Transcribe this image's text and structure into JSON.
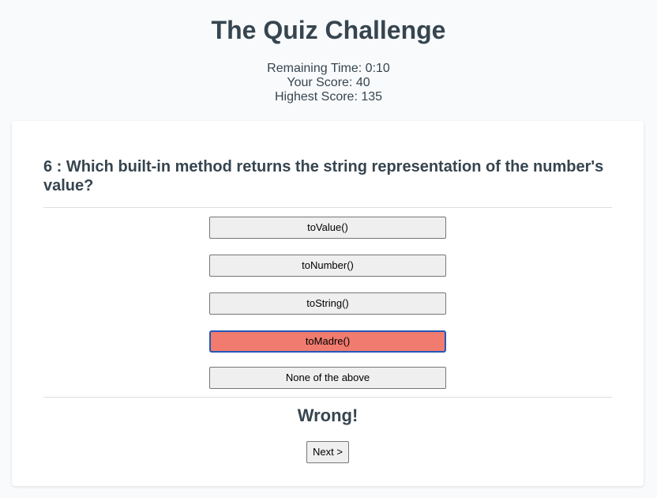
{
  "header": {
    "title": "The Quiz Challenge",
    "remaining_time": "Remaining Time: 0:10",
    "your_score": "Your Score: 40",
    "highest_score": "Highest Score: 135"
  },
  "quiz": {
    "question": "6 : Which built-in method returns the string representation of the number's value?",
    "answers": [
      "toValue()",
      "toNumber()",
      "toString()",
      "toMadre()",
      "None of the above"
    ],
    "selected_index": 3,
    "result": "Wrong!",
    "next_label": "Next >"
  },
  "colors": {
    "wrong_answer_bg": "#f07b6e",
    "selected_border": "#2359b8",
    "text": "#36454f"
  }
}
